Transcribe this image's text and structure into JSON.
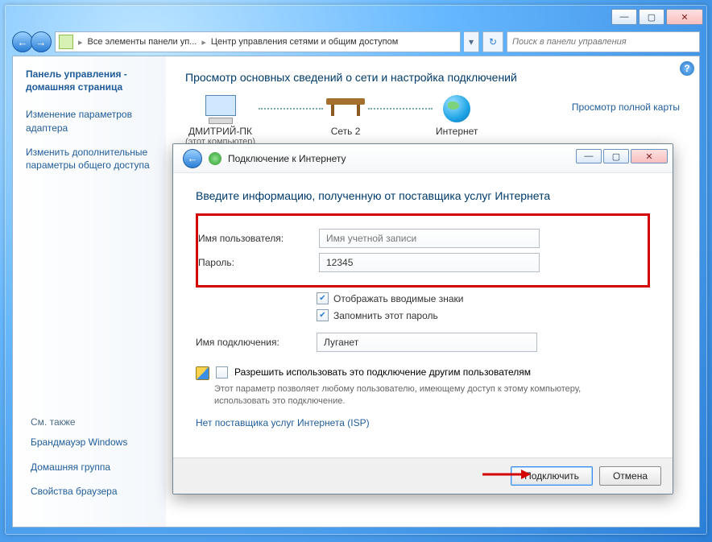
{
  "breadcrumb": {
    "part1": "Все элементы панели уп...",
    "part2": "Центр управления сетями и общим доступом"
  },
  "search": {
    "placeholder": "Поиск в панели управления"
  },
  "sidebar": {
    "home": "Панель управления - домашняя страница",
    "links": [
      "Изменение параметров адаптера",
      "Изменить дополнительные параметры общего доступа"
    ],
    "see_also_title": "См. также",
    "see_also": [
      "Брандмауэр Windows",
      "Домашняя группа",
      "Свойства браузера"
    ]
  },
  "main": {
    "heading": "Просмотр основных сведений о сети и настройка подключений",
    "full_map": "Просмотр полной карты",
    "nodes": {
      "pc_name": "ДМИТРИЙ-ПК",
      "pc_sub": "(этот компьютер)",
      "network": "Сеть 2",
      "internet": "Интернет"
    }
  },
  "wizard": {
    "title": "Подключение к Интернету",
    "heading": "Введите информацию, полученную от поставщика услуг Интернета",
    "labels": {
      "user": "Имя пользователя:",
      "pass": "Пароль:",
      "conn": "Имя подключения:"
    },
    "fields": {
      "user_placeholder": "Имя учетной записи",
      "pass_value": "12345",
      "conn_value": "Луганет"
    },
    "checks": {
      "show_chars": "Отображать вводимые знаки",
      "remember": "Запомнить этот пароль"
    },
    "allow": {
      "label": "Разрешить использовать это подключение другим пользователям",
      "desc": "Этот параметр позволяет любому пользователю, имеющему доступ к этому компьютеру, использовать это подключение."
    },
    "isp_link": "Нет поставщика услуг Интернета (ISP)",
    "buttons": {
      "connect": "Подключить",
      "cancel": "Отмена"
    }
  }
}
